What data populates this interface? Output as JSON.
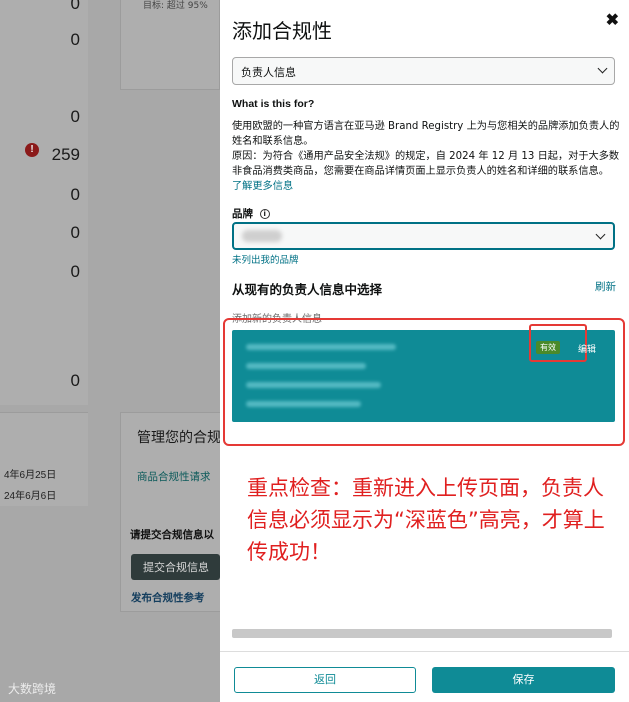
{
  "background": {
    "numbers": [
      "0",
      "0",
      "0",
      "259",
      "0",
      "0",
      "0",
      "0"
    ],
    "top_card_text": "目标: 超过 95%",
    "dates": [
      "4年6月25日",
      "24年6月6日"
    ],
    "manage_title": "管理您的合规",
    "manage_link": "商品合规性请求",
    "bold_text": "请提交合规信息以",
    "dark_button": "提交合规信息",
    "bold_link": "发布合规性参考",
    "alert_icon": "!"
  },
  "watermark": "大数跨境",
  "modal": {
    "title": "添加合规性",
    "close_label": "✖",
    "type_select": "负责人信息",
    "what_heading": "What is this for?",
    "description": "使用欧盟的一种官方语言在亚马逊 Brand Registry 上为与您相关的品牌添加负责人的姓名和联系信息。",
    "reason": "原因：为符合《通用产品安全法规》的规定，自 2024 年 12 月 13 日起，对于大多数非食品消费类商品，您需要在商品详情页面上显示负责人的姓名和详细的联系信息。",
    "learn_more": "了解更多信息",
    "brand_label": "品牌",
    "info_icon": "i",
    "brand_not_listed": "未列出我的品牌",
    "choose_existing": "从现有的负责人信息中选择",
    "refresh": "刷新",
    "add_new": "添加新的负责人信息",
    "badge": "有效",
    "edit": "编辑",
    "back_button": "返回",
    "save_button": "保存"
  },
  "annotation": "重点检查：重新进入上传页面，负责人信息必须显示为“深蓝色”高亮，才算上传成功！",
  "colors": {
    "accent": "#0f8b96",
    "highlight_red": "#e53935",
    "badge_green": "#4a8a2a"
  }
}
